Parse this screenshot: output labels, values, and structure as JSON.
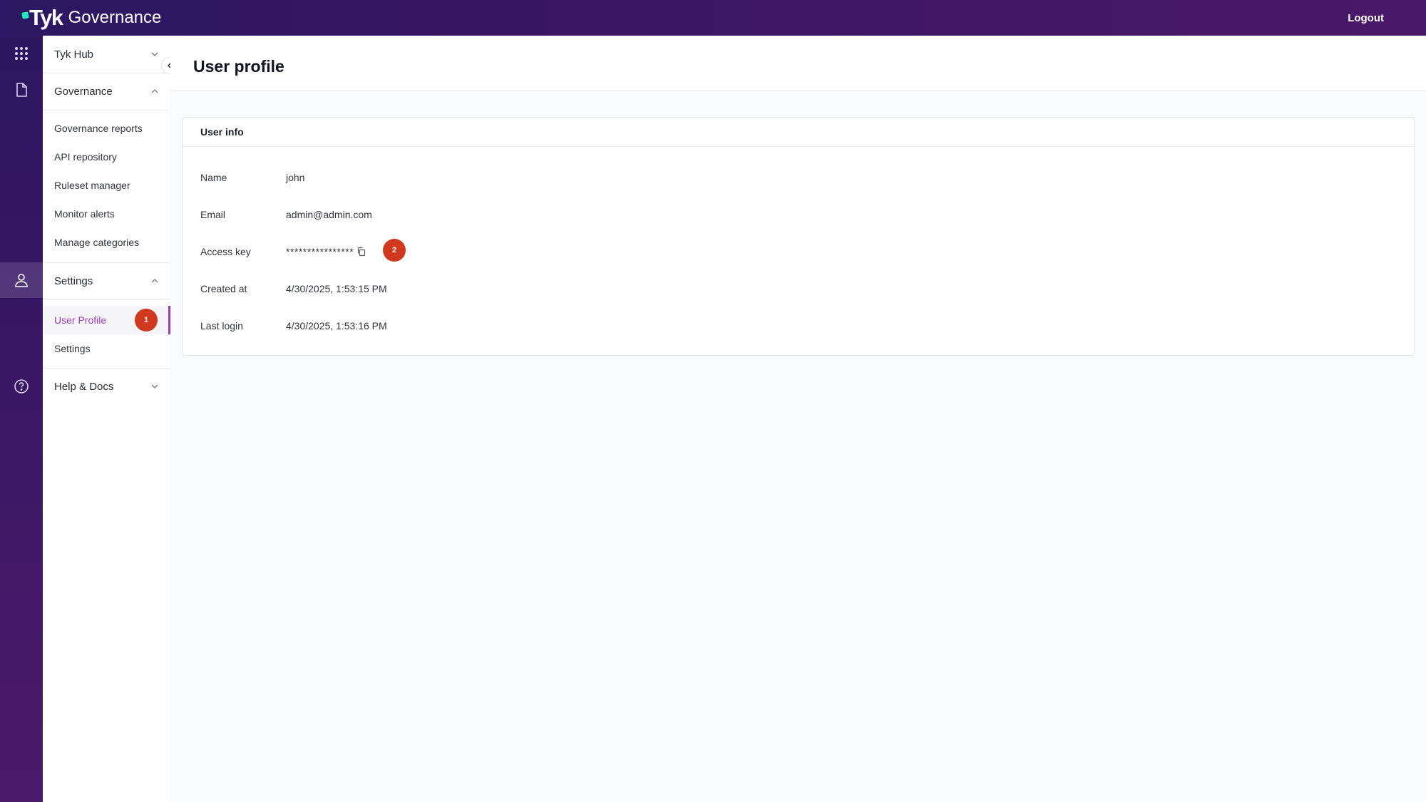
{
  "app": {
    "brand": "Tyk",
    "product": "Governance",
    "logout_label": "Logout",
    "accent_color": "#9a3bb8",
    "badge_color": "#d1391f"
  },
  "rail": {
    "icons": [
      "apps-grid-icon",
      "document-icon",
      "user-icon",
      "help-circle-icon"
    ]
  },
  "sidebar": {
    "sections": {
      "tyk_hub": "Tyk Hub",
      "governance": "Governance",
      "settings": "Settings",
      "help_docs": "Help & Docs"
    },
    "governance_items": [
      "Governance reports",
      "API repository",
      "Ruleset manager",
      "Monitor alerts",
      "Manage categories"
    ],
    "settings_items": [
      "User Profile",
      "Settings"
    ],
    "active_item": "User Profile"
  },
  "badges": {
    "first": "1",
    "second": "2"
  },
  "page": {
    "title": "User profile"
  },
  "user_info": {
    "card_title": "User info",
    "rows": [
      {
        "label": "Name",
        "value": "john"
      },
      {
        "label": "Email",
        "value": "admin@admin.com"
      },
      {
        "label": "Access key",
        "value": "****************"
      },
      {
        "label": "Created at",
        "value": "4/30/2025, 1:53:15 PM"
      },
      {
        "label": "Last login",
        "value": "4/30/2025, 1:53:16 PM"
      }
    ]
  }
}
